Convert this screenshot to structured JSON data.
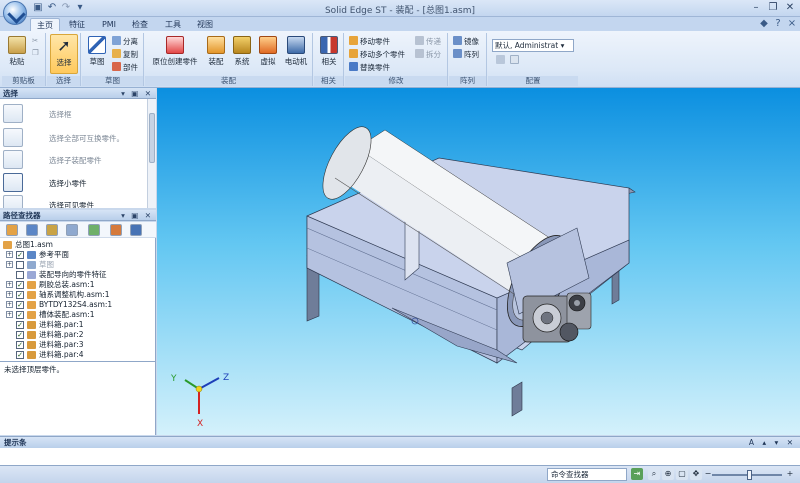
{
  "titlebar": {
    "app_name": "Solid Edge ST",
    "separator": " - ",
    "document": "装配 - [总图1.asm]"
  },
  "tabs": [
    "主页",
    "特征",
    "PMI",
    "检查",
    "工具",
    "视图"
  ],
  "active_tab": "主页",
  "ribbon": {
    "clipboard": {
      "label": "剪贴板",
      "paste": "粘贴"
    },
    "select": {
      "label": "选择",
      "select": "选择"
    },
    "sketch": {
      "label": "草图",
      "sketch": "草图",
      "split": "分离",
      "copy": "复制",
      "part": "部件"
    },
    "assembly": {
      "label": "装配",
      "create_in_place": "原位创建零件",
      "assemble": "装配",
      "system": "系统",
      "virtual": "虚拟",
      "motor": "电动机"
    },
    "relate": {
      "label": "相关",
      "relate": "相关"
    },
    "modify": {
      "label": "修改",
      "move_part": "移动零件",
      "move_multiple": "移动多个零件",
      "replace_part": "替换零件",
      "transfer": "传递",
      "disperse": "拆分"
    },
    "pattern": {
      "label": "阵列",
      "mirror": "镜像",
      "pattern": "阵列"
    },
    "config": {
      "label": "配置",
      "value": "默认, Administrat"
    }
  },
  "select_pane": {
    "title": "选择",
    "items": [
      {
        "label": "选择框",
        "active": false
      },
      {
        "label": "选择全部可互换零件。",
        "active": false
      },
      {
        "label": "选择子装配零件",
        "active": false
      },
      {
        "label": "选择小零件",
        "active": true
      },
      {
        "label": "选择可见零件",
        "active": false
      }
    ]
  },
  "path_finder": {
    "title": "路径查找器",
    "root": "总图1.asm",
    "rows": [
      {
        "label": "参考平面",
        "expand": true,
        "checked": true,
        "dim": false
      },
      {
        "label": "草图",
        "expand": true,
        "checked": false,
        "dim": true
      },
      {
        "label": "装配导向的零件特征",
        "expand": false,
        "checked": false,
        "dim": false
      },
      {
        "label": "刷胶总装.asm:1",
        "expand": true,
        "checked": true,
        "dim": false
      },
      {
        "label": "轴系调整机构.asm:1",
        "expand": true,
        "checked": true,
        "dim": false
      },
      {
        "label": "BYTDY132S4.asm:1",
        "expand": true,
        "checked": true,
        "dim": false
      },
      {
        "label": "槽体装配.asm:1",
        "expand": true,
        "checked": true,
        "dim": false
      },
      {
        "label": "进料箱.par:1",
        "expand": false,
        "checked": true,
        "dim": false
      },
      {
        "label": "进料箱.par:2",
        "expand": false,
        "checked": true,
        "dim": false
      },
      {
        "label": "进料箱.par:3",
        "expand": false,
        "checked": true,
        "dim": false
      },
      {
        "label": "进料箱.par:4",
        "expand": false,
        "checked": true,
        "dim": false
      }
    ],
    "status": "未选择顶层零件。"
  },
  "viewport": {
    "axes": {
      "x": "X",
      "y": "Y",
      "z": "Z"
    },
    "colors": {
      "sky_top": "#0b8fe0",
      "sky_bottom": "#d4f1fb",
      "steel": "#c8d4ee",
      "drum": "#f4f6f8"
    }
  },
  "prompt_bar": {
    "title": "提示条"
  },
  "statusbar": {
    "command_finder": "命令查找器"
  }
}
